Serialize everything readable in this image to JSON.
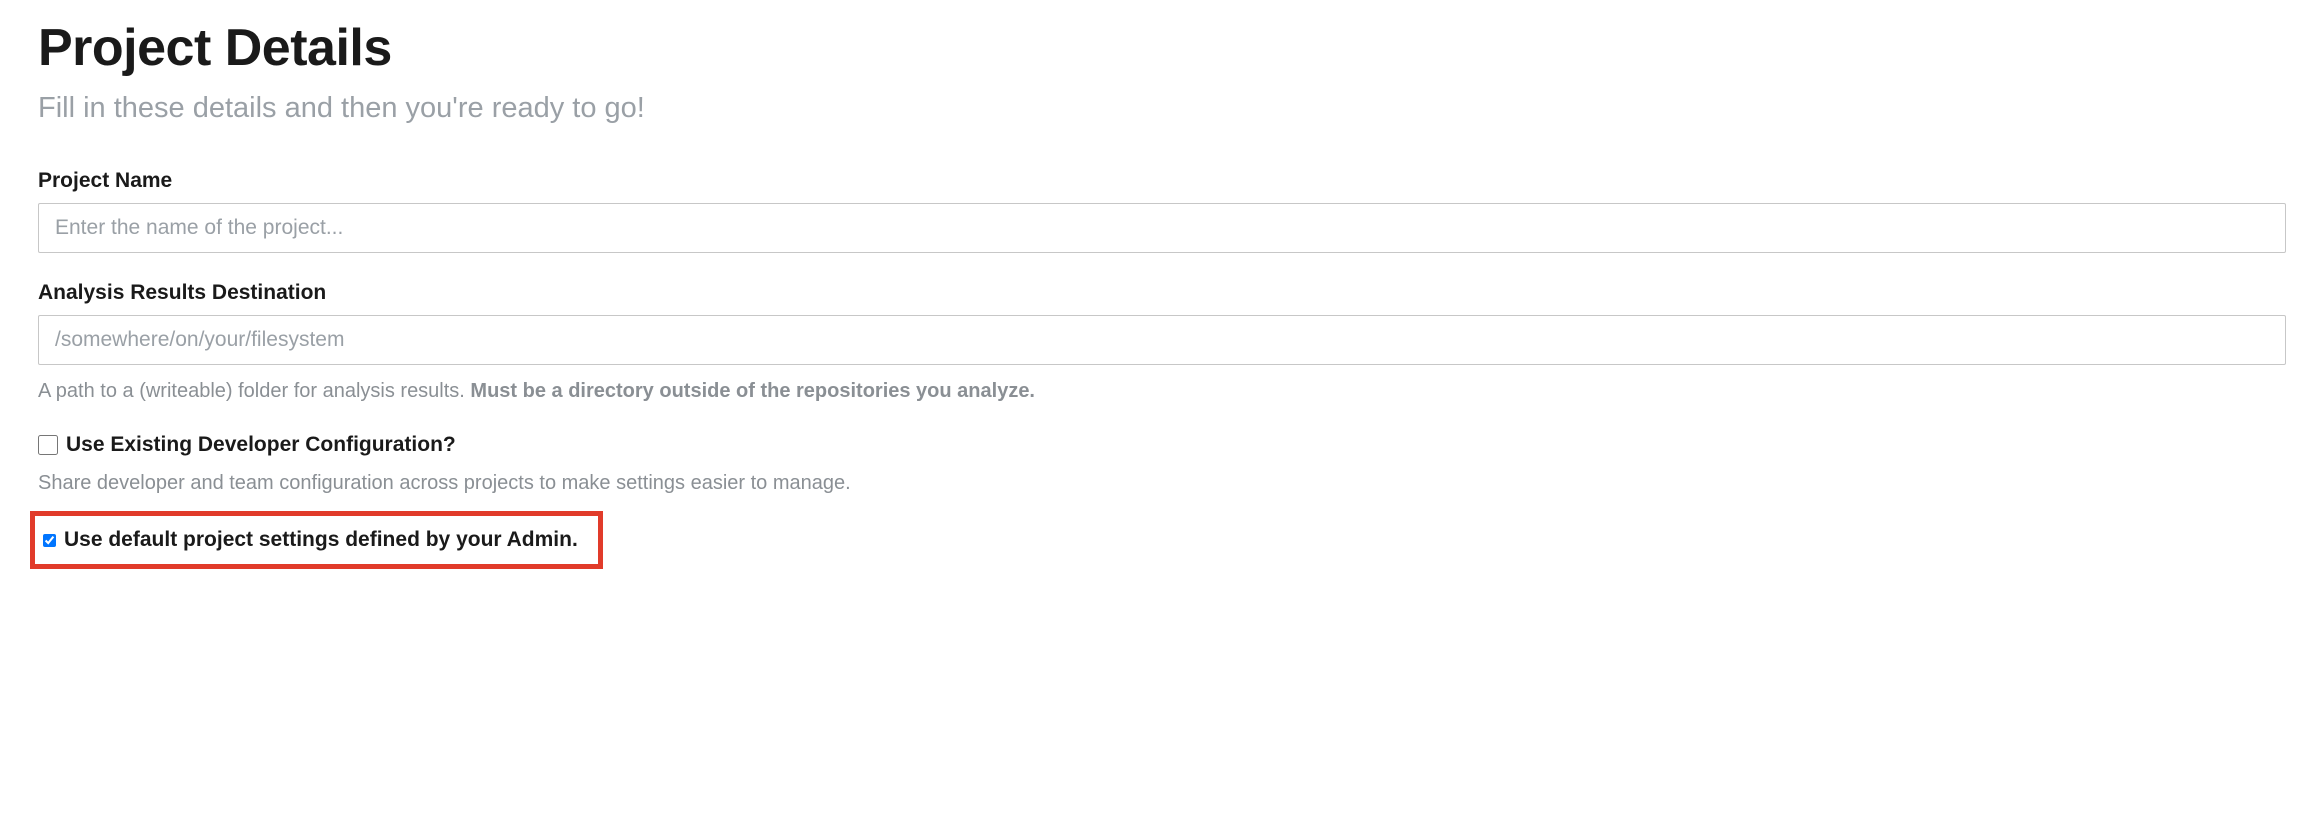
{
  "page": {
    "title": "Project Details",
    "subtitle": "Fill in these details and then you're ready to go!"
  },
  "fields": {
    "projectName": {
      "label": "Project Name",
      "placeholder": "Enter the name of the project...",
      "value": ""
    },
    "analysisDest": {
      "label": "Analysis Results Destination",
      "placeholder": "/somewhere/on/your/filesystem",
      "value": "",
      "helpPrefix": "A path to a (writeable) folder for analysis results. ",
      "helpBold": "Must be a directory outside of the repositories you analyze."
    }
  },
  "options": {
    "useExisting": {
      "label": "Use Existing Developer Configuration?",
      "checked": false,
      "help": "Share developer and team configuration across projects to make settings easier to manage."
    },
    "useDefault": {
      "label": "Use default project settings defined by your Admin.",
      "checked": true
    }
  }
}
